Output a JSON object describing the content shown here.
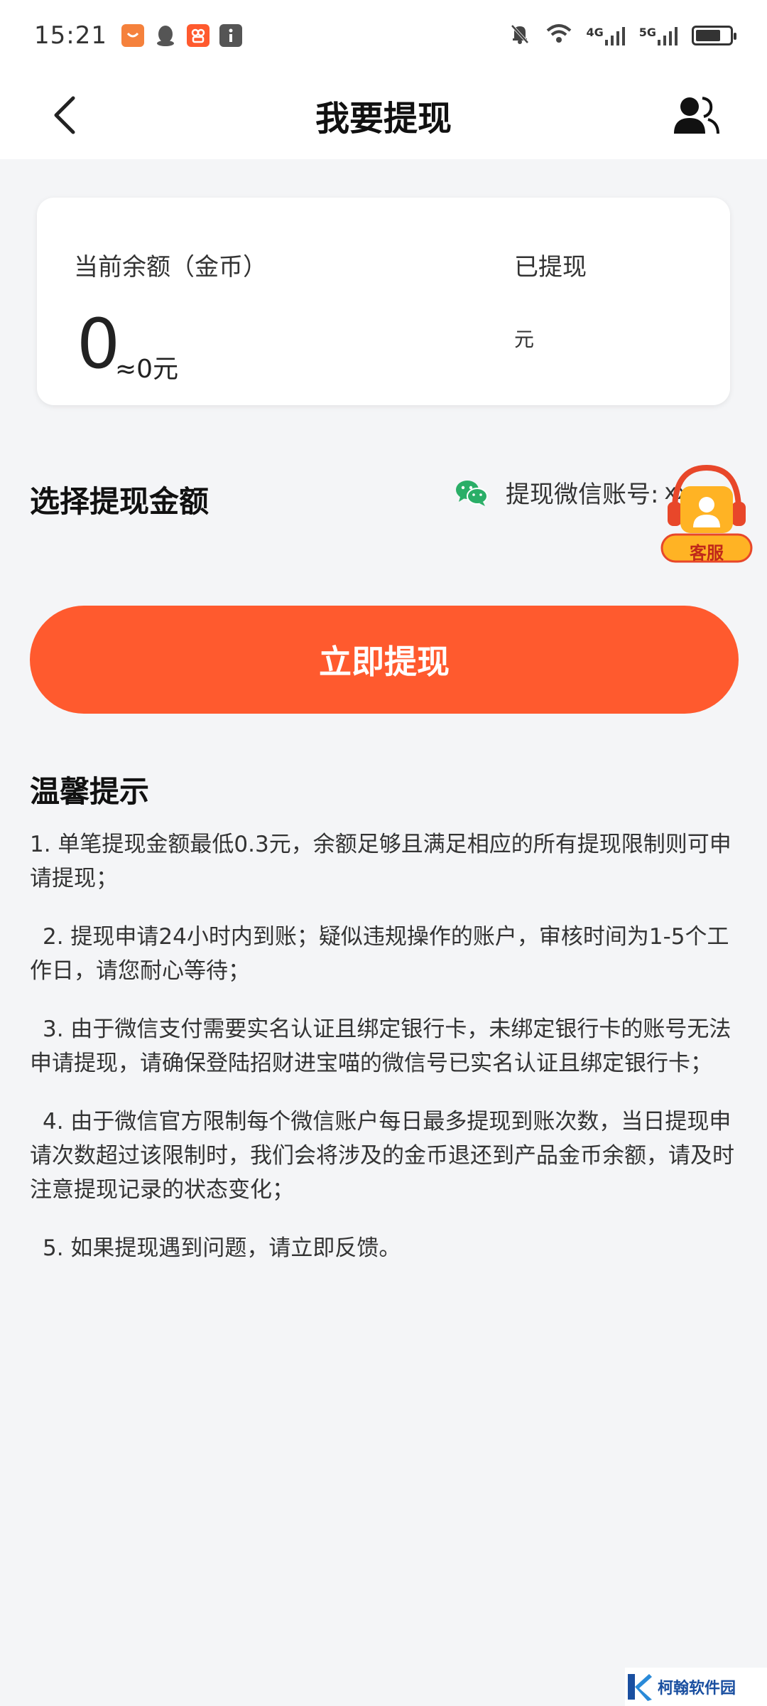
{
  "status_bar": {
    "time": "15:21",
    "net_4g": "4G",
    "net_5g": "5G"
  },
  "nav": {
    "title": "我要提现"
  },
  "balance": {
    "current_label": "当前余额（金币）",
    "current_value": "0",
    "current_approx": "≈0元",
    "withdrawn_label": "已提现",
    "withdrawn_unit": "元"
  },
  "select": {
    "title": "选择提现金额",
    "wechat_label": "提现微信账号:",
    "wechat_account": "xxx"
  },
  "customer_service": {
    "label": "客服"
  },
  "actions": {
    "withdraw_label": "立即提现"
  },
  "tips": {
    "title": "温馨提示",
    "items": [
      "1. 单笔提现金额最低0.3元，余额足够且满足相应的所有提现限制则可申请提现；",
      "2. 提现申请24小时内到账；疑似违规操作的账户，审核时间为1-5个工作日，请您耐心等待；",
      "3. 由于微信支付需要实名认证且绑定银行卡，未绑定银行卡的账号无法申请提现，请确保登陆招财进宝喵的微信号已实名认证且绑定银行卡；",
      "4. 由于微信官方限制每个微信账户每日最多提现到账次数，当日提现申请次数超过该限制时，我们会将涉及的金币退还到产品金币余额，请及时注意提现记录的状态变化；",
      "5. 如果提现遇到问题，请立即反馈。"
    ]
  },
  "watermark": {
    "text": "柯翰软件园"
  },
  "colors": {
    "accent": "#ff5a2e",
    "wechat": "#2aae67",
    "background": "#f4f5f7"
  }
}
